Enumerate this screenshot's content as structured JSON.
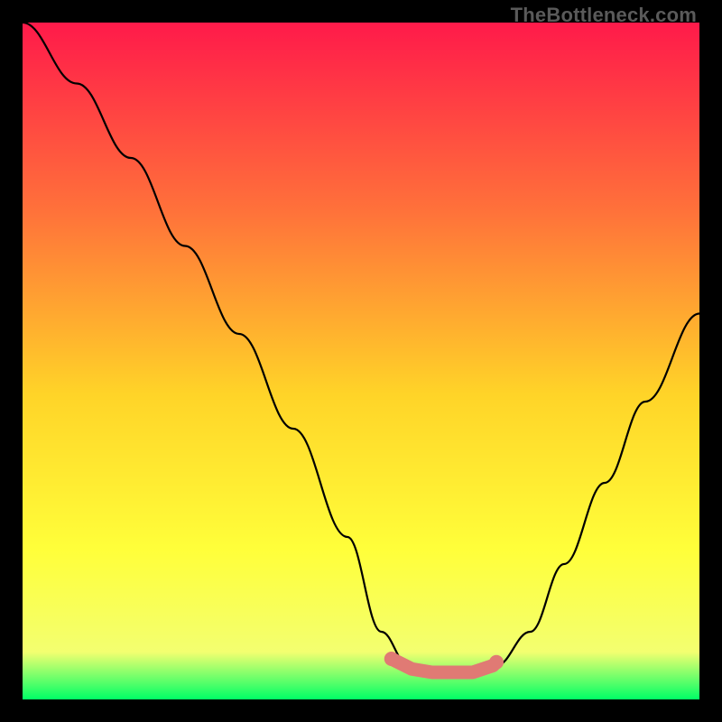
{
  "watermark": "TheBottleneck.com",
  "colors": {
    "background": "#000000",
    "gradient_top": "#ff1a4a",
    "gradient_upper_mid": "#ff723a",
    "gradient_mid": "#ffd428",
    "gradient_lower_mid": "#ffff3a",
    "gradient_near_bottom": "#f3ff70",
    "gradient_bottom": "#00ff66",
    "curve_stroke": "#000000",
    "marker_fill": "#e07a74"
  },
  "chart_data": {
    "type": "line",
    "title": "",
    "xlabel": "",
    "ylabel": "",
    "xlim": [
      0,
      1
    ],
    "ylim": [
      0,
      1
    ],
    "series": [
      {
        "name": "bottleneck-curve",
        "x": [
          0.0,
          0.08,
          0.16,
          0.24,
          0.32,
          0.4,
          0.48,
          0.53,
          0.57,
          0.61,
          0.65,
          0.7,
          0.75,
          0.8,
          0.86,
          0.92,
          1.0
        ],
        "values": [
          1.0,
          0.91,
          0.8,
          0.67,
          0.54,
          0.4,
          0.24,
          0.1,
          0.05,
          0.04,
          0.04,
          0.05,
          0.1,
          0.2,
          0.32,
          0.44,
          0.57
        ]
      }
    ],
    "markers": {
      "name": "highlighted-range",
      "x": [
        0.545,
        0.575,
        0.605,
        0.635,
        0.665,
        0.695,
        0.7
      ],
      "values": [
        0.06,
        0.045,
        0.04,
        0.04,
        0.04,
        0.05,
        0.055
      ]
    }
  }
}
